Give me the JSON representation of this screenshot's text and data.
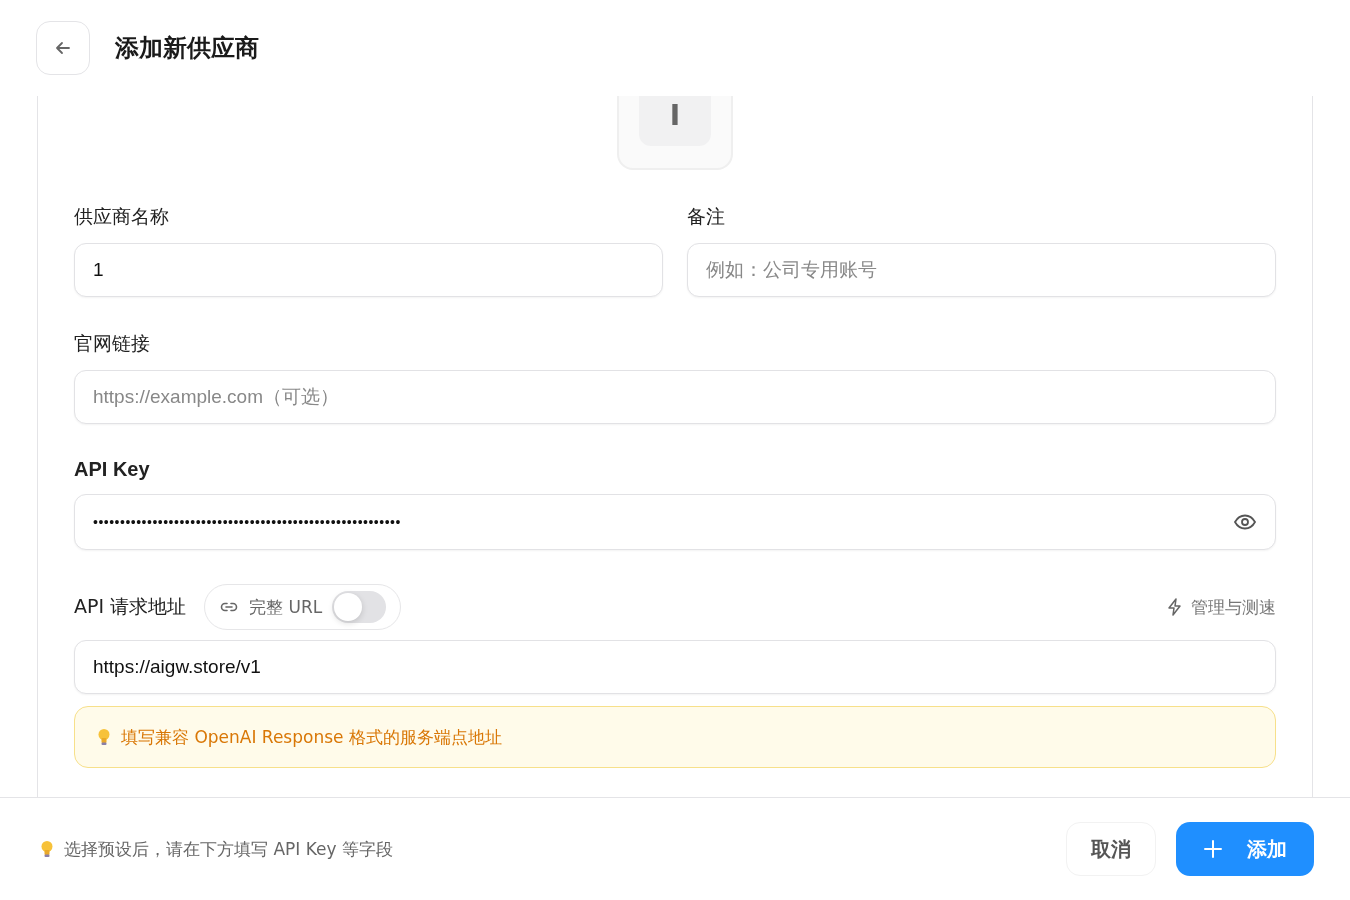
{
  "header": {
    "title": "添加新供应商"
  },
  "icon_tile": {
    "letter": "I"
  },
  "fields_row": [
    {
      "label": "供应商名称",
      "value": "1"
    },
    {
      "label": "备注",
      "placeholder": "例如：公司专用账号"
    }
  ],
  "website": {
    "label": "官网链接",
    "placeholder": "https://example.com（可选）"
  },
  "api_key": {
    "label": "API Key",
    "masked_value": "•••••••••••••••••••••••••••••••••••••••••••••••••••••••••"
  },
  "endpoint": {
    "label": "API 请求地址",
    "full_url_toggle": {
      "label": "完整 URL",
      "on": false
    },
    "manage_link": "管理与测速",
    "value": "https://aigw.store/v1",
    "hint": "填写兼容 OpenAI Response 格式的服务端点地址"
  },
  "footer": {
    "tip": "选择预设后，请在下方填写 API Key 等字段",
    "buttons": [
      {
        "kind": "secondary",
        "label": "取消"
      },
      {
        "kind": "primary",
        "label": "添加"
      }
    ]
  }
}
